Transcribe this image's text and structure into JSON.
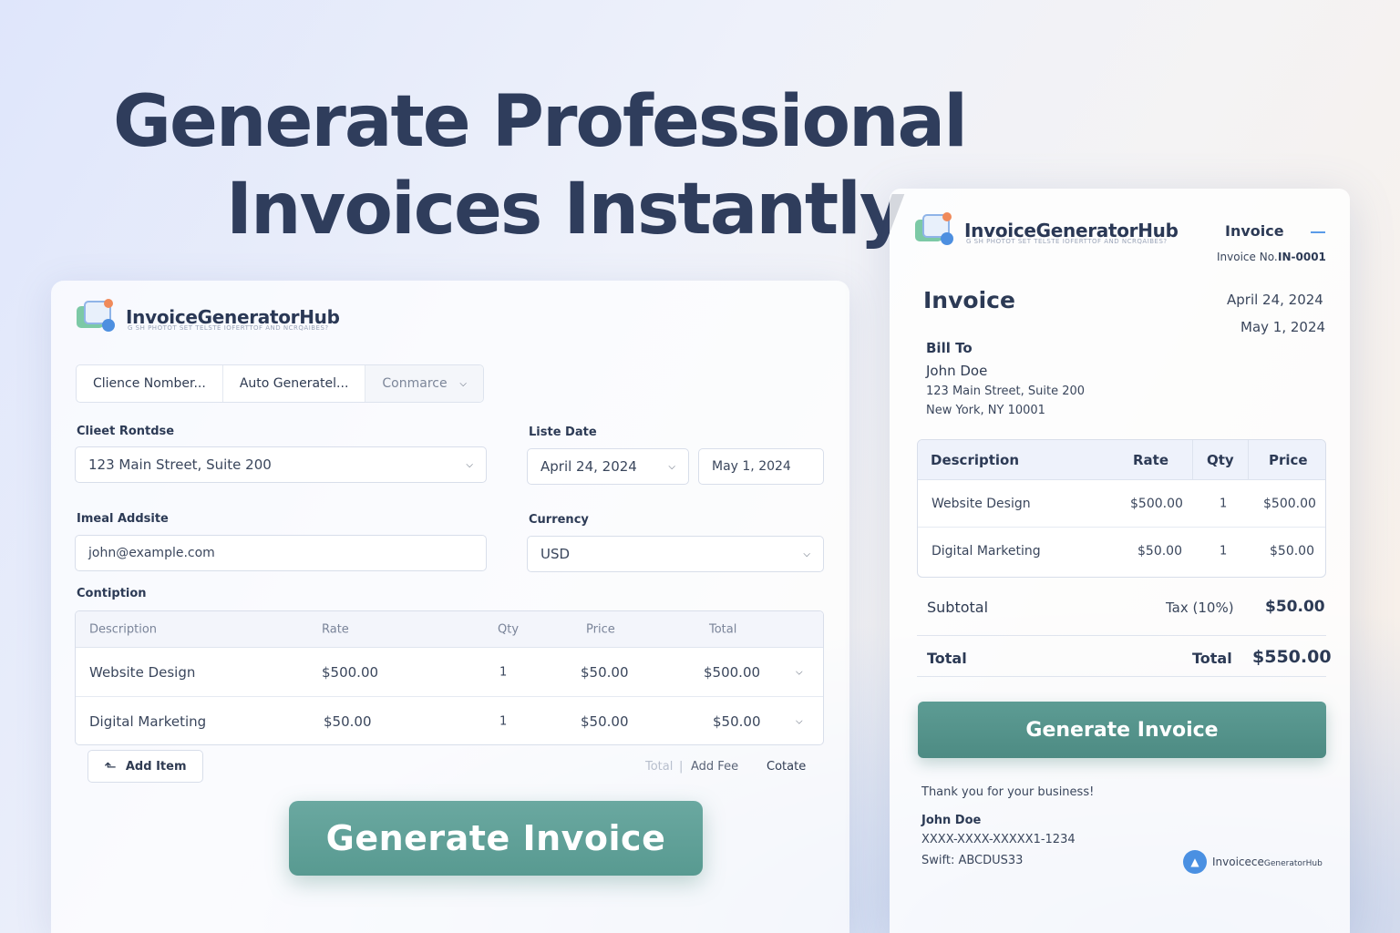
{
  "hero": {
    "line1": "Generate Professional",
    "line2": "Invoices Instantly"
  },
  "form": {
    "brand_name": "InvoiceGeneratorHub",
    "brand_tagline": "G SH PHOTOT SET TELSTE IOFERTTOF AND NCRQAIBES?",
    "segment": {
      "item1": "Clience Nomber...",
      "item2": "Auto Generatel...",
      "item3": "Conmarce"
    },
    "client_label": "Clieet Rontdse",
    "client_value": "123 Main Street, Suite 200",
    "date_label": "Liste Date",
    "date1": "April 24, 2024",
    "date2": "May 1, 2024",
    "email_label": "Imeal Addsite",
    "email_value": "john@example.com",
    "currency_label": "Currency",
    "currency_value": "USD",
    "section_label": "Contiption",
    "table": {
      "headers": [
        "Description",
        "Rate",
        "Qty",
        "Price",
        "Total"
      ],
      "rows": [
        [
          "Website Design",
          "$500.00",
          "1",
          "$50.00",
          "$500.00"
        ],
        [
          "Digital Marketing",
          "$50.00",
          "1",
          "$50.00",
          "$50.00"
        ]
      ]
    },
    "add_item": "Add Item",
    "link_total": "Total",
    "link_sep": "|",
    "link_add_fee": "Add Fee",
    "link_cotate": "Cotate",
    "generate": "Generate Invoice"
  },
  "preview": {
    "brand_name": "InvoiceGeneratorHub",
    "brand_tagline": "G SH PHOTOT SET TELSTE IOFERTTOF AND NCRQAIBES?",
    "doc_type": "Invoice",
    "invoice_no_label": "Invoice No.",
    "invoice_no": "IN-0001",
    "title": "Invoice",
    "date1": "April 24, 2024",
    "date2": "May 1, 2024",
    "bill_to_label": "Bill To",
    "bill_name": "John Doe",
    "bill_addr1": "123 Main Street, Suite 200",
    "bill_addr2": "New York, NY 10001",
    "table": {
      "headers": [
        "Description",
        "Rate",
        "Qty",
        "Price"
      ],
      "rows": [
        [
          "Website Design",
          "$500.00",
          "1",
          "$500.00"
        ],
        [
          "Digital Marketing",
          "$50.00",
          "1",
          "$50.00"
        ]
      ]
    },
    "subtotal_label": "Subtotal",
    "tax_label": "Tax (10%)",
    "tax_value": "$50.00",
    "total_label": "Total",
    "total_label2": "Total",
    "total_value": "$550.00",
    "generate": "Generate Invoice",
    "thanks": "Thank you for your business!",
    "footer_name": "John Doe",
    "footer_account": "XXXX-XXXX-XXXXX1-1234",
    "footer_swift": "Swift: ABCDUS33",
    "footer_brand_a": "Invoicece",
    "footer_brand_b": "GeneratorHub"
  },
  "colors": {
    "accent_green": "#589a91",
    "heading": "#2f3d5c",
    "brand_blue": "#4a90e2"
  },
  "icons": {
    "logo": "invoice-logo-icon",
    "chevron": "chevron-down-icon",
    "add": "plus-icon",
    "footer_logo": "brand-mark-icon"
  }
}
